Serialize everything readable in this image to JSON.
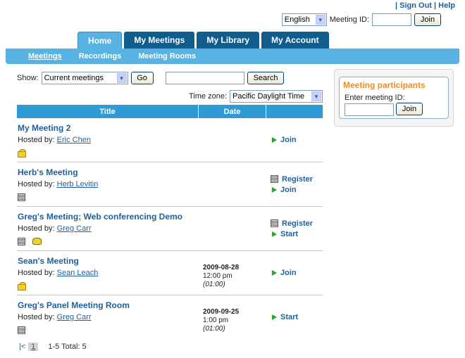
{
  "toplinks": {
    "sign_out": "Sign Out",
    "help": "Help"
  },
  "topbar": {
    "language": "English",
    "meeting_id_label": "Meeting ID:",
    "join_label": "Join"
  },
  "tabs": [
    {
      "label": "Home",
      "active": true
    },
    {
      "label": "My Meetings",
      "active": false
    },
    {
      "label": "My Library",
      "active": false
    },
    {
      "label": "My Account",
      "active": false
    }
  ],
  "subnav": [
    {
      "label": "Meetings",
      "selected": true
    },
    {
      "label": "Recordings",
      "selected": false
    },
    {
      "label": "Meeting Rooms",
      "selected": false
    }
  ],
  "filters": {
    "show_label": "Show:",
    "show_value": "Current meetings",
    "go_label": "Go",
    "search_value": "",
    "search_label": "Search",
    "timezone_label": "Time zone:",
    "timezone_value": "Pacific Daylight Time"
  },
  "table": {
    "headers": {
      "title": "Title",
      "date": "Date"
    },
    "hosted_by_label": "Hosted by:",
    "rows": [
      {
        "title": "My Meeting 2",
        "host": "Eric Chen",
        "date": "",
        "time": "",
        "duration": "",
        "icons": [
          "lock-icon"
        ],
        "actions": [
          "Join"
        ]
      },
      {
        "title": "Herb's Meeting",
        "host": "Herb Levitin",
        "date": "",
        "time": "",
        "duration": "",
        "icons": [
          "agenda-icon"
        ],
        "actions": [
          "Register",
          "Join"
        ]
      },
      {
        "title": "Greg's Meeting; Web conferencing Demo",
        "host": "Greg Carr",
        "date": "",
        "time": "",
        "duration": "",
        "icons": [
          "agenda-icon",
          "phone-icon"
        ],
        "actions": [
          "Register",
          "Start"
        ]
      },
      {
        "title": "Sean's Meeting",
        "host": "Sean Leach",
        "date": "2009-08-28",
        "time": "12:00 pm",
        "duration": "(01:00)",
        "icons": [
          "lock-icon"
        ],
        "actions": [
          "Join"
        ]
      },
      {
        "title": "Greg's Panel Meeting Room",
        "host": "Greg Carr",
        "date": "2009-09-25",
        "time": "1:00 pm",
        "duration": "(01:00)",
        "icons": [
          "agenda-icon"
        ],
        "actions": [
          "Start"
        ]
      }
    ]
  },
  "pager": {
    "first": "|<",
    "page": "1",
    "total": "1-5 Total: 5"
  },
  "participants": {
    "title": "Meeting participants",
    "label": "Enter meeting ID:",
    "input_value": "",
    "join_label": "Join"
  },
  "colors": {
    "tab_dark": "#0e5d8e",
    "tab_active": "#58b2e2",
    "header_blue": "#2e9bd6",
    "link_blue": "#1f5f9c",
    "panel_title_orange": "#f08c1e"
  }
}
